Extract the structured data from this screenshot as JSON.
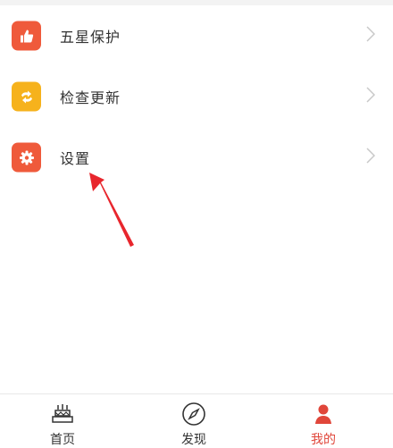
{
  "menu": {
    "items": [
      {
        "label": "五星保护",
        "icon": "thumbs-up-icon",
        "color": "#ef5a3b"
      },
      {
        "label": "检查更新",
        "icon": "refresh-icon",
        "color": "#f6b21c"
      },
      {
        "label": "设置",
        "icon": "gear-icon",
        "color": "#ef5a3b"
      }
    ]
  },
  "tabbar": {
    "tabs": [
      {
        "label": "首页",
        "icon": "home-cake-icon"
      },
      {
        "label": "发现",
        "icon": "compass-icon"
      },
      {
        "label": "我的",
        "icon": "user-icon",
        "active": true
      }
    ]
  },
  "colors": {
    "accent": "#e0463a",
    "arrow": "#e8262d"
  }
}
